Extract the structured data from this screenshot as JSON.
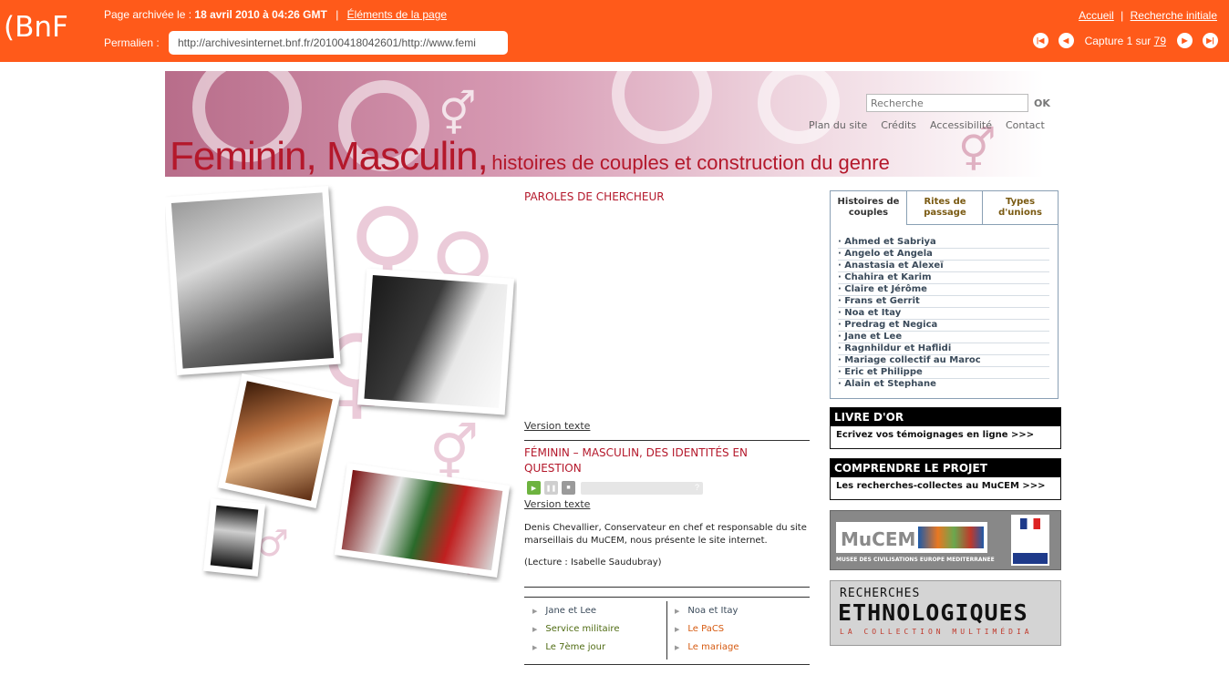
{
  "archive_bar": {
    "logo": "(BnF",
    "archived_label": "Page archivée le :",
    "archived_date": "18 avril 2010 à 04:26 GMT",
    "separator": "|",
    "page_elements_link": "Éléments de la page",
    "permalink_label": "Permalien :",
    "permalink_value": "http://archivesinternet.bnf.fr/20100418042601/http://www.femi",
    "home_link": "Accueil",
    "initial_search_link": "Recherche initiale",
    "capture_label": "Capture 1 sur",
    "capture_total": "79",
    "nav_icons": [
      "first-icon",
      "previous-icon",
      "next-icon",
      "last-icon"
    ]
  },
  "site_header": {
    "title_main": "Feminin, Masculin,",
    "title_sub": "histoires de couples et construction du genre",
    "search_placeholder": "Recherche",
    "search_button": "OK",
    "links": [
      "Plan du site",
      "Crédits",
      "Accessibilité",
      "Contact"
    ]
  },
  "center": {
    "section_title": "PAROLES DE CHERCHEUR",
    "version_texte_1": "Version texte",
    "audio_title": "FÉMININ – MASCULIN, DES IDENTITÉS EN QUESTION",
    "player_help": "?",
    "version_texte_2": "Version texte",
    "description": "Denis Chevallier, Conservateur en chef et responsable du site marseillais du MuCEM, nous présente le site internet.",
    "reading_credit": "(Lecture : Isabelle Saudubray)",
    "links_left": [
      {
        "label": "Jane et Lee",
        "color": "#3a4a5a"
      },
      {
        "label": "Service militaire",
        "color": "#4f6b12"
      },
      {
        "label": "Le 7ème jour",
        "color": "#4f6b12"
      }
    ],
    "links_right": [
      {
        "label": "Noa et Itay",
        "color": "#3a4a5a"
      },
      {
        "label": "Le PaCS",
        "color": "#d65a10"
      },
      {
        "label": "Le mariage",
        "color": "#d65a10"
      }
    ]
  },
  "sidebar": {
    "tabs": [
      "Histoires de couples",
      "Rites de passage",
      "Types d'unions"
    ],
    "couples": [
      "· Ahmed et Sabriya",
      "· Angelo et Angela",
      "· Anastasia et Alexeï",
      "· Chahira et Karim",
      "· Claire et Jérôme",
      "· Frans et Gerrit",
      "· Noa et Itay",
      "· Predrag et Negica",
      "· Jane et Lee",
      "· Ragnhildur et Haflidi",
      "· Mariage collectif au Maroc",
      "· Eric et Philippe",
      "· Alain et Stephane"
    ],
    "livre_dor_title": "LIVRE D'OR",
    "livre_dor_text": "Ecrivez vos témoignages en ligne >>>",
    "projet_title": "COMPRENDRE LE PROJET",
    "projet_text": "Les recherches-collectes au MuCEM >>>",
    "mucem_logo": "MuCEM",
    "mucem_caption": "MUSEE DES CIVILISATIONS EUROPE MEDITERRANEE",
    "rech_line1": "RECHERCHES",
    "rech_line2": "ETHNOLOGIQUES",
    "rech_line3": "LA COLLECTION MULTIMÉDIA"
  }
}
